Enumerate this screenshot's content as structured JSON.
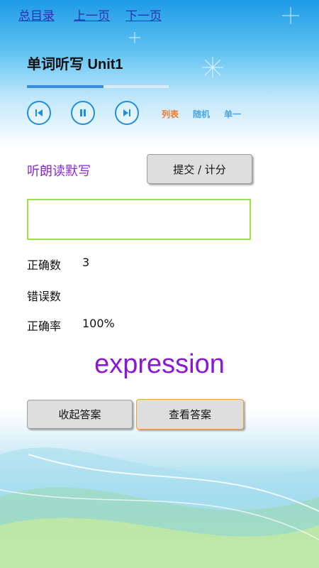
{
  "nav": {
    "toc": "总目录",
    "prev": "上一页",
    "next": "下一页"
  },
  "title": "单词听写 Unit1",
  "progress": 0.54,
  "controls": {
    "icons": [
      "skip-previous-icon",
      "pause-icon",
      "skip-next-icon"
    ],
    "modes": [
      {
        "label": "列表",
        "color": "#f07a2b"
      },
      {
        "label": "随机",
        "color": "#4ba6e8"
      },
      {
        "label": "单一",
        "color": "#4ba6e8"
      }
    ]
  },
  "dictation_label": "听朗读默写",
  "submit_label": "提交 / 计分",
  "answer_input": {
    "value": "",
    "placeholder": ""
  },
  "stats": {
    "correct_label": "正确数",
    "correct_value": "3",
    "wrong_label": "错误数",
    "wrong_value": "",
    "rate_label": "正确率",
    "rate_value": "100%"
  },
  "answer_word": "expression",
  "buttons": {
    "hide_answer": "收起答案",
    "view_answer": "查看答案"
  },
  "colors": {
    "accent": "#1e8fe0",
    "purple": "#8a18d6",
    "input_border": "#9ce04a"
  }
}
